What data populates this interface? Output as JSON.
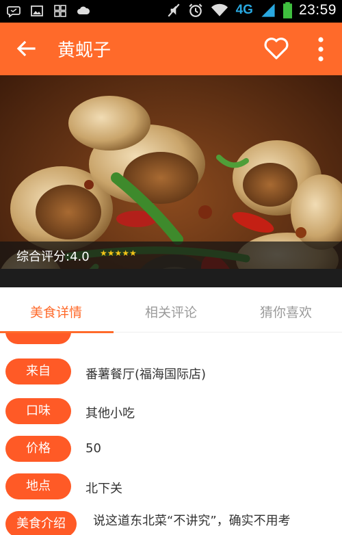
{
  "statusbar": {
    "time": "23:59",
    "network": "4G",
    "left_icons": [
      "message-icon",
      "image-icon",
      "grid-icon",
      "cloud-icon"
    ],
    "right_icons": [
      "mute-icon",
      "alarm-icon",
      "wifi-icon",
      "signal-icon",
      "battery-icon"
    ]
  },
  "appbar": {
    "title": "黄蚬子",
    "back_icon": "arrow-left-icon",
    "favorite_icon": "heart-outline-icon",
    "more_icon": "more-vertical-icon",
    "bg_color": "#ff6a2a"
  },
  "hero": {
    "rating_label": "综合评分:4.0",
    "rating_value": 4.0,
    "stars_text": "★★★★★"
  },
  "tabs": [
    {
      "label": "美食详情",
      "active": true
    },
    {
      "label": "相关评论",
      "active": false
    },
    {
      "label": "猜你喜欢",
      "active": false
    }
  ],
  "details": {
    "rows": [
      {
        "label": "来自",
        "value": "番薯餐厅(福海国际店)"
      },
      {
        "label": "口味",
        "value": "其他小吃"
      },
      {
        "label": "价格",
        "value": "50"
      },
      {
        "label": "地点",
        "value": "北下关"
      }
    ],
    "intro_label": "美食介绍",
    "intro_text": "说这道东北菜“不讲究”，确实不用考"
  },
  "colors": {
    "accent": "#ff6a2a",
    "pill": "#ff5a26",
    "tab_inactive": "#9a9a9a"
  }
}
